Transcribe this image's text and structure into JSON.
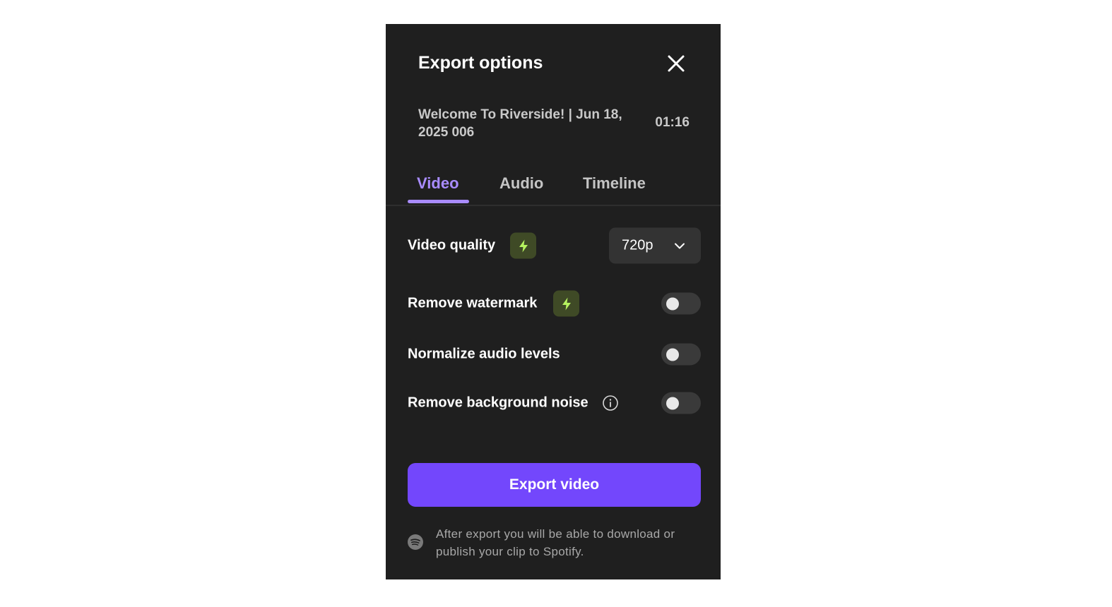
{
  "dialog": {
    "title": "Export options",
    "close_label": "Close"
  },
  "clip": {
    "name": "Welcome To Riverside! | Jun 18, 2025 006",
    "duration": "01:16"
  },
  "tabs": [
    {
      "label": "Video",
      "active": true
    },
    {
      "label": "Audio",
      "active": false
    },
    {
      "label": "Timeline",
      "active": false
    }
  ],
  "settings": {
    "video_quality": {
      "label": "Video quality",
      "premium_icon": "bolt-icon",
      "value": "720p"
    },
    "remove_watermark": {
      "label": "Remove watermark",
      "premium_icon": "bolt-icon",
      "enabled": false
    },
    "normalize_audio": {
      "label": "Normalize audio levels",
      "enabled": false
    },
    "remove_noise": {
      "label": "Remove background noise",
      "info_icon": "info-icon",
      "enabled": false
    }
  },
  "export_button": {
    "label": "Export video"
  },
  "footer": {
    "icon": "spotify-icon",
    "note": "After export you will be able to download or publish your clip to Spotify."
  },
  "colors": {
    "accent": "#7347fc",
    "tab_active": "#a98cff",
    "bolt": "#b6f25f",
    "background": "#1f1f1f"
  }
}
